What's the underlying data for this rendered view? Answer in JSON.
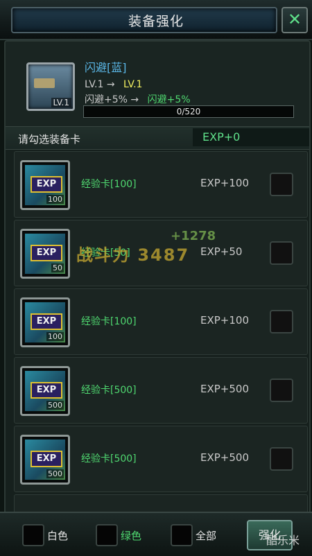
{
  "header": {
    "title": "装备强化",
    "close_icon": "close-icon"
  },
  "equipment": {
    "name": "闪避[蓝]",
    "icon_level": "LV.1",
    "level_from": "LV.1",
    "arrow": "→",
    "level_to": "LV.1",
    "stat_from": "闪避+5%",
    "stat_to": "闪避+5%",
    "xp_text": "0/520",
    "xp_progress": 0
  },
  "select_bar": {
    "label": "请勾选装备卡",
    "exp_total": "EXP+0"
  },
  "cards": [
    {
      "badge": "EXP",
      "value": "100",
      "name": "经验卡[100]",
      "gain": "EXP+100"
    },
    {
      "badge": "EXP",
      "value": "50",
      "name": "经验卡[50]",
      "gain": "EXP+50"
    },
    {
      "badge": "EXP",
      "value": "100",
      "name": "经验卡[100]",
      "gain": "EXP+100"
    },
    {
      "badge": "EXP",
      "value": "500",
      "name": "经验卡[500]",
      "gain": "EXP+500"
    },
    {
      "badge": "EXP",
      "value": "500",
      "name": "经验卡[500]",
      "gain": "EXP+500"
    }
  ],
  "overlay": {
    "power": "战斗力 3487",
    "plus": "+1278"
  },
  "filters": [
    {
      "label": "白色",
      "color": "#e6e6e6"
    },
    {
      "label": "绿色",
      "color": "#4fd870"
    },
    {
      "label": "全部",
      "color": "#e6e6e6"
    }
  ],
  "actions": {
    "enhance": "强化"
  },
  "watermark": "酷乐米"
}
